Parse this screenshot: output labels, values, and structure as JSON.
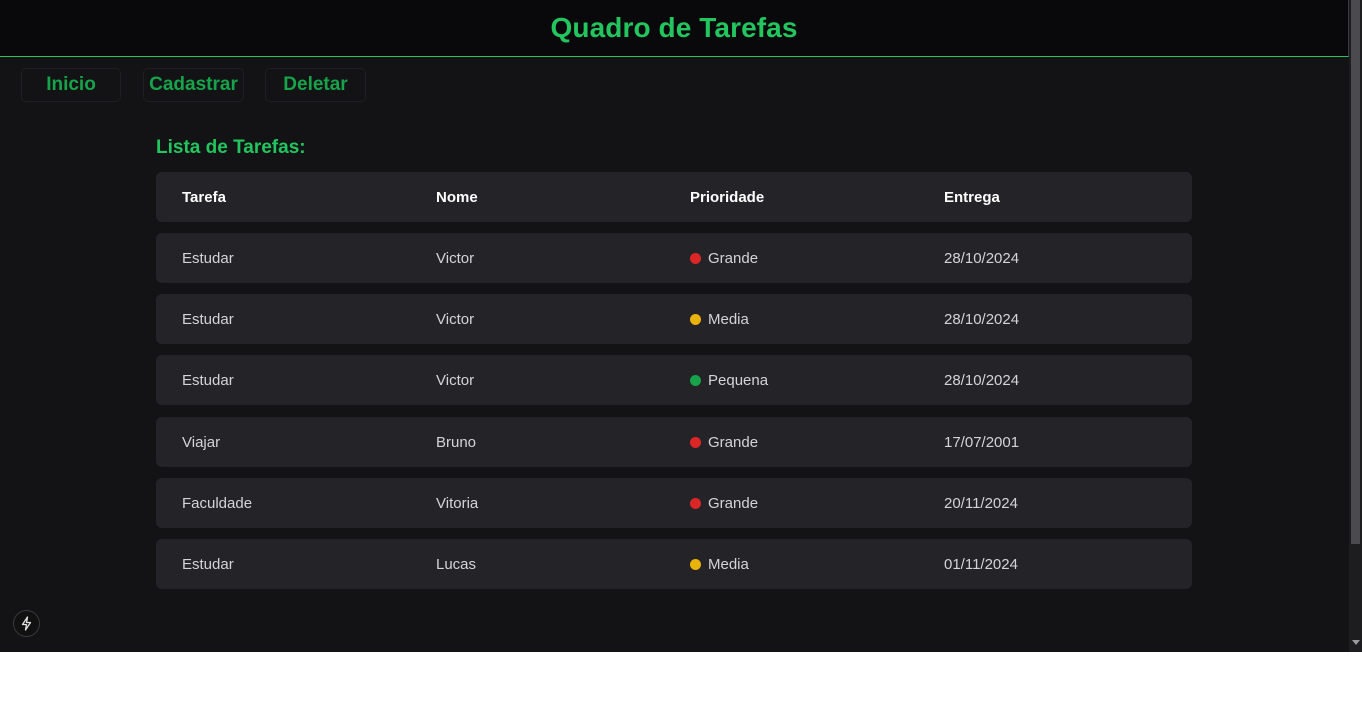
{
  "header": {
    "title": "Quadro de Tarefas"
  },
  "nav": {
    "items": [
      {
        "label": "Inicio"
      },
      {
        "label": "Cadastrar"
      },
      {
        "label": "Deletar"
      }
    ]
  },
  "list": {
    "title": "Lista de Tarefas:",
    "columns": [
      "Tarefa",
      "Nome",
      "Prioridade",
      "Entrega"
    ],
    "rows": [
      {
        "tarefa": "Estudar",
        "nome": "Victor",
        "prioridade": "Grande",
        "entrega": "28/10/2024",
        "color": "#dc2626"
      },
      {
        "tarefa": "Estudar",
        "nome": "Victor",
        "prioridade": "Media",
        "entrega": "28/10/2024",
        "color": "#eab308"
      },
      {
        "tarefa": "Estudar",
        "nome": "Victor",
        "prioridade": "Pequena",
        "entrega": "28/10/2024",
        "color": "#16a34a"
      },
      {
        "tarefa": "Viajar",
        "nome": "Bruno",
        "prioridade": "Grande",
        "entrega": "17/07/2001",
        "color": "#dc2626"
      },
      {
        "tarefa": "Faculdade",
        "nome": "Vitoria",
        "prioridade": "Grande",
        "entrega": "20/11/2024",
        "color": "#dc2626"
      },
      {
        "tarefa": "Estudar",
        "nome": "Lucas",
        "prioridade": "Media",
        "entrega": "01/11/2024",
        "color": "#eab308"
      }
    ]
  },
  "colors": {
    "accent": "#22c55e",
    "background": "#131315",
    "row": "#242428"
  },
  "icons": {
    "dev_indicator": "lightning-icon"
  }
}
